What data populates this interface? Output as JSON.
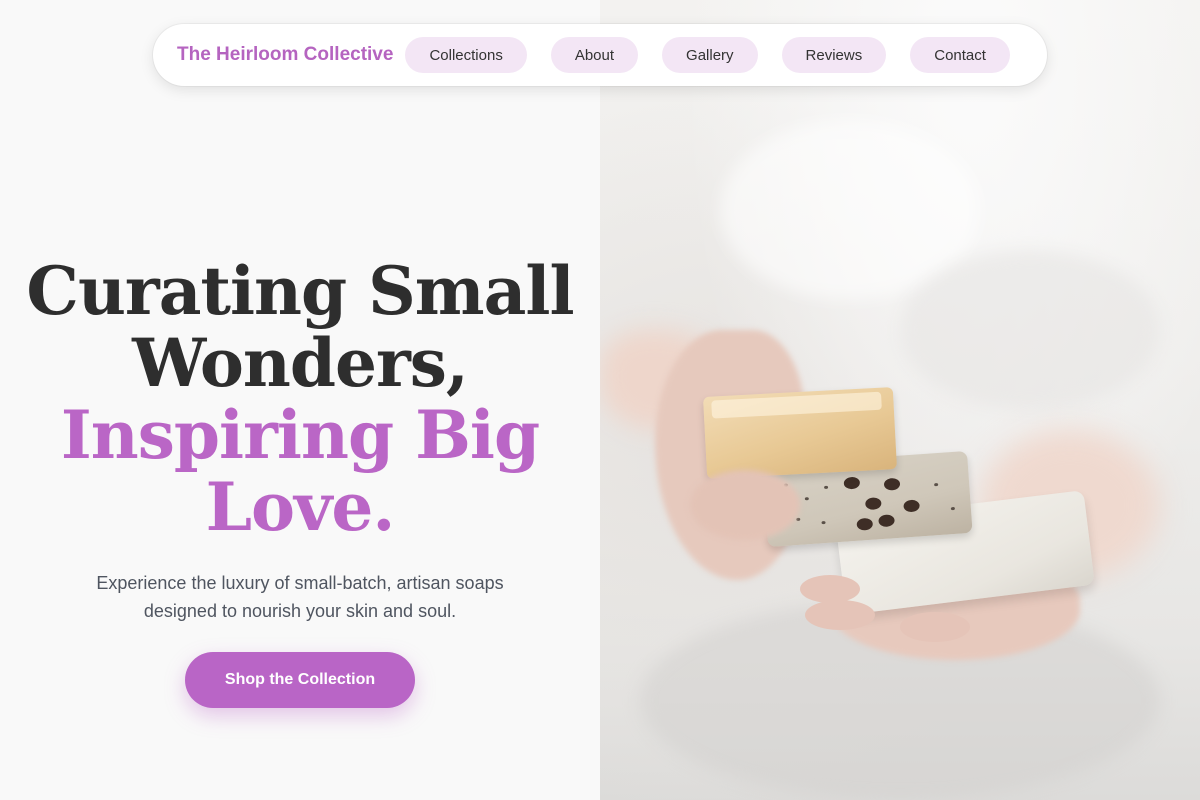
{
  "nav": {
    "brand": "The Heirloom Collective",
    "links": [
      {
        "label": "Collections"
      },
      {
        "label": "About"
      },
      {
        "label": "Gallery"
      },
      {
        "label": "Reviews"
      },
      {
        "label": "Contact"
      }
    ]
  },
  "hero": {
    "headline_line1": "Curating Small",
    "headline_line2": "Wonders,",
    "accent_line1": "Inspiring Big",
    "accent_line2": "Love.",
    "subtitle": "Experience the luxury of small-batch, artisan soaps designed to nourish your skin and soul.",
    "cta_label": "Shop the Collection"
  },
  "colors": {
    "accent": "#b965c6",
    "nav_pill": "#f3e6f5",
    "heading": "#2e2e2e",
    "body_text": "#4f5560"
  },
  "image": {
    "subject": "hands-holding-soap-bars-photo"
  }
}
